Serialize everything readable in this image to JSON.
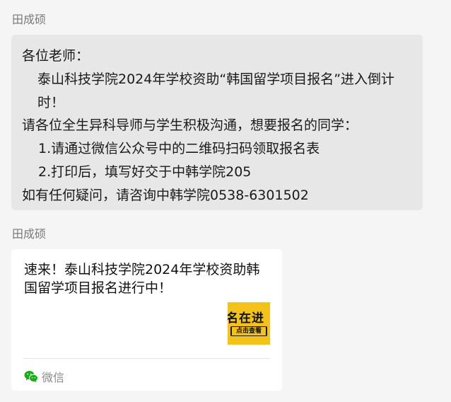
{
  "messages": [
    {
      "sender": "田成硕",
      "lines": [
        "各位老师：",
        "泰山科技学院2024年学校资助“韩国留学项目报名”进入倒计时！",
        "请各位全生异科导师与学生积极沟通，想要报名的同学：",
        "1.请通过微信公众号中的二维码扫码领取报名表",
        "2.打印后，填写好交于中韩学院205",
        "如有任何疑问，请咨询中韩学院0538-6301502"
      ]
    },
    {
      "sender": "田成硕",
      "card": {
        "title": "速来！泰山科技学院2024年学校资助韩国留学项目报名进行中！",
        "thumbnail_text": "名在进",
        "thumbnail_button": "点击查看",
        "source": "微信",
        "source_icon": "wechat-icon",
        "colors": {
          "thumbnail": "#f4c21a",
          "wechat_green": "#1aad19"
        }
      }
    }
  ]
}
